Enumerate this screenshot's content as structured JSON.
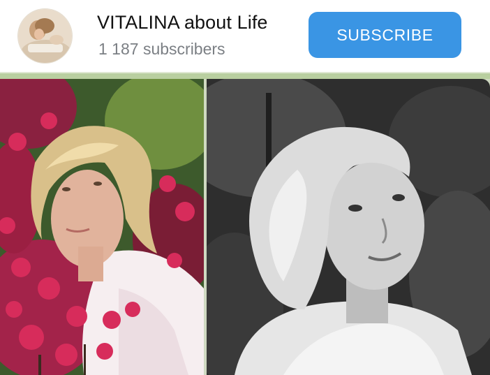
{
  "channel": {
    "name": "VITALINA about Life",
    "subscribers": "1 187 subscribers",
    "subscribe_label": "SUBSCRIBE"
  },
  "colors": {
    "subscribe_button": "#3a95e4",
    "accent_strip": "#b9cfa0",
    "name_text": "#111111",
    "subscribers_text": "#7b7f84"
  },
  "icons": {
    "avatar": "channel-avatar-photo"
  },
  "photos": [
    {
      "name": "woman-with-red-flowers-photo",
      "style": "color"
    },
    {
      "name": "woman-in-white-fur-photo",
      "style": "black-and-white"
    }
  ]
}
